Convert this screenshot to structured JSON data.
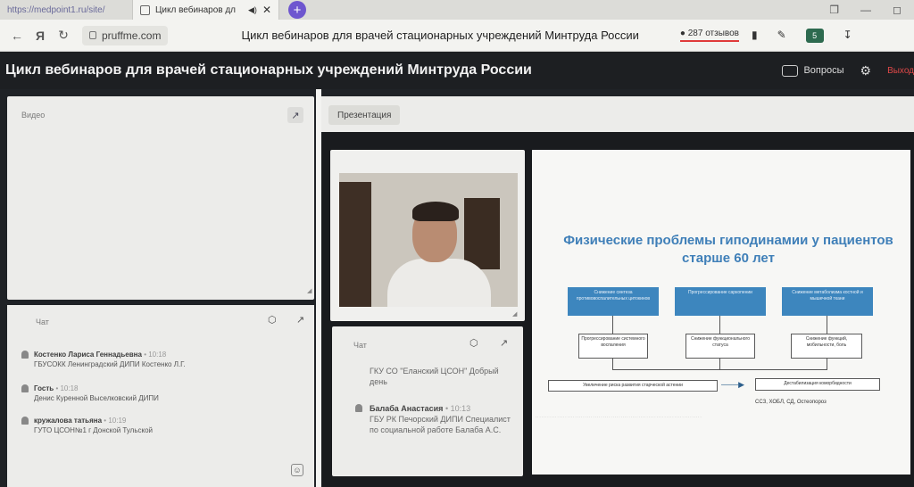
{
  "browser": {
    "tabs": [
      {
        "title": "https://medpoint1.ru/site/",
        "active": false
      },
      {
        "title": "Цикл вебинаров дл",
        "active": true
      }
    ],
    "address": {
      "domain": "pruffme.com",
      "page_title": "Цикл вебинаров для врачей стационарных учреждений Минтруда России",
      "reviews": "287 отзывов"
    },
    "icons": [
      "back-icon",
      "yandex-icon",
      "reload-icon",
      "lock-icon",
      "bookmark-icon",
      "pen-icon",
      "extension-icon",
      "download-icon"
    ]
  },
  "header": {
    "title": "Цикл вебинаров для врачей стационарных учреждений Минтруда России",
    "questions_label": "Вопросы",
    "exit_label": "Выход"
  },
  "video_panel": {
    "label": "Видео"
  },
  "chat_left": {
    "label": "Чат",
    "messages": [
      {
        "name": "Костенко Лариса Геннадьевна",
        "time": "10:18",
        "text": "ГБУСОКК Ленинградский ДИПИ Костенко Л.Г."
      },
      {
        "name": "Гость",
        "time": "10:18",
        "text": "Денис Куренной Выселковский ДИПИ"
      },
      {
        "name": "кружалова татьяна",
        "time": "10:19",
        "text": "ГУТО ЦСОН№1 г Донской Тульской"
      }
    ]
  },
  "presentation": {
    "button_label": "Презентация"
  },
  "chat_mid": {
    "label": "Чат",
    "messages": [
      {
        "name": "",
        "time": "",
        "text": "ГКУ СО \"Еланский ЦСОН\" Добрый день"
      },
      {
        "name": "Балаба Анастасия",
        "time": "10:13",
        "text": "ГБУ РК Печорский ДИПИ Специалист по социальной работе Балаба А.С."
      }
    ]
  },
  "slide": {
    "title": "Физические проблемы гиподинамии у пациентов старше 60 лет",
    "top_boxes": [
      "Снижение синтеза противовоспалительных цитокинов",
      "Прогрессирование саркопении",
      "Снижение метаболизма костной и мышечной ткани"
    ],
    "mid_boxes": [
      "Прогрессирование системного воспаления",
      "Снижение функционального статуса",
      "Снижение функций, мобильности, боль"
    ],
    "bottom_left": "Увеличение риска развития старческой астении",
    "bottom_right": "Дестабилизация коморбидности",
    "authors": "ССЗ, ХОБЛ, СД, Остеопороз"
  },
  "colors": {
    "app_header": "#1d1f22",
    "panel": "#ececea",
    "slide_title": "#3f7fb8",
    "slide_box": "#3d86be",
    "reviews_underline": "#e03a3a",
    "newtab": "#6e56cf"
  }
}
